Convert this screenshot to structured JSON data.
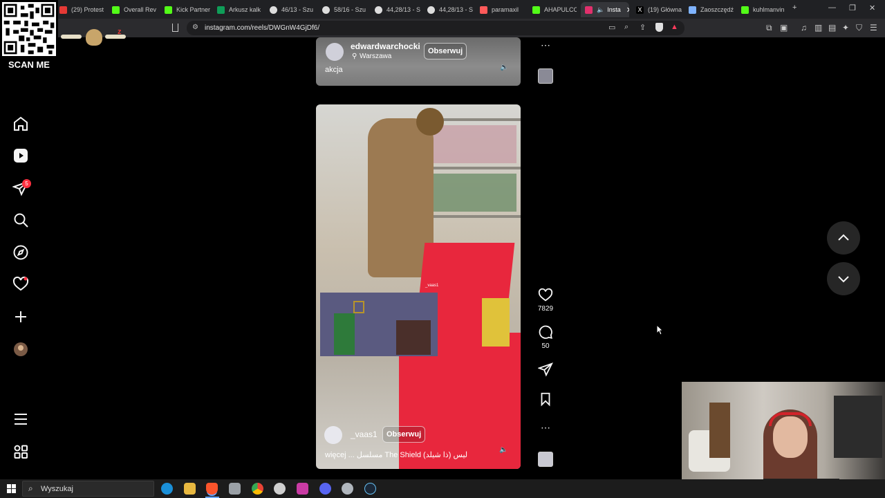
{
  "browser": {
    "tabs": [
      {
        "label": "(29) Protest",
        "color": "#e53935"
      },
      {
        "label": "Overall Rev",
        "color": "#53fc18"
      },
      {
        "label": "Kick Partner",
        "color": "#53fc18"
      },
      {
        "label": "Arkusz kalk",
        "color": "#0f9d58"
      },
      {
        "label": "46/13 - Szu",
        "color": "#dddddd"
      },
      {
        "label": "58/16 - Szu",
        "color": "#dddddd"
      },
      {
        "label": "44,28/13 - S",
        "color": "#dddddd"
      },
      {
        "label": "44,28/13 - S",
        "color": "#dddddd"
      },
      {
        "label": "paramaxil",
        "color": "#ff5a5a"
      },
      {
        "label": "AHAPULCO",
        "color": "#53fc18"
      },
      {
        "label": "Insta",
        "color": "#e1306c"
      },
      {
        "label": "(19) Główna",
        "color": "#ffffff"
      },
      {
        "label": "Zaoszczędź",
        "color": "#7fb3ff"
      },
      {
        "label": "kuhlmanvin",
        "color": "#53fc18"
      }
    ],
    "url": "instagram.com/reels/DWGnW4GjDf6/"
  },
  "overlay": {
    "qr_label": "SCAN ME"
  },
  "sidebar": {
    "notification_count": "5",
    "items": [
      "home-icon",
      "reels-icon",
      "messages-icon",
      "search-icon",
      "explore-icon",
      "notifications-icon",
      "create-icon",
      "profile-avatar",
      "menu-icon",
      "more-apps-icon"
    ]
  },
  "reel_top": {
    "username": "edwardwarchocki",
    "location": "Warszawa",
    "follow_label": "Obserwuj",
    "caption": "akcja"
  },
  "reel_main": {
    "username": "_vaas1",
    "follow_label": "Obserwuj",
    "caption": "więcej ... مسلسل The Shield (ذا شيلد) ليس",
    "watermark": "_vaas1"
  },
  "actions": {
    "likes": "7829",
    "comments": "50"
  },
  "taskbar": {
    "search_label": "Wyszukaj"
  },
  "colors": {
    "accent_badge": "#ff3040",
    "background": "#000000",
    "crate_red": "#e8273d"
  }
}
